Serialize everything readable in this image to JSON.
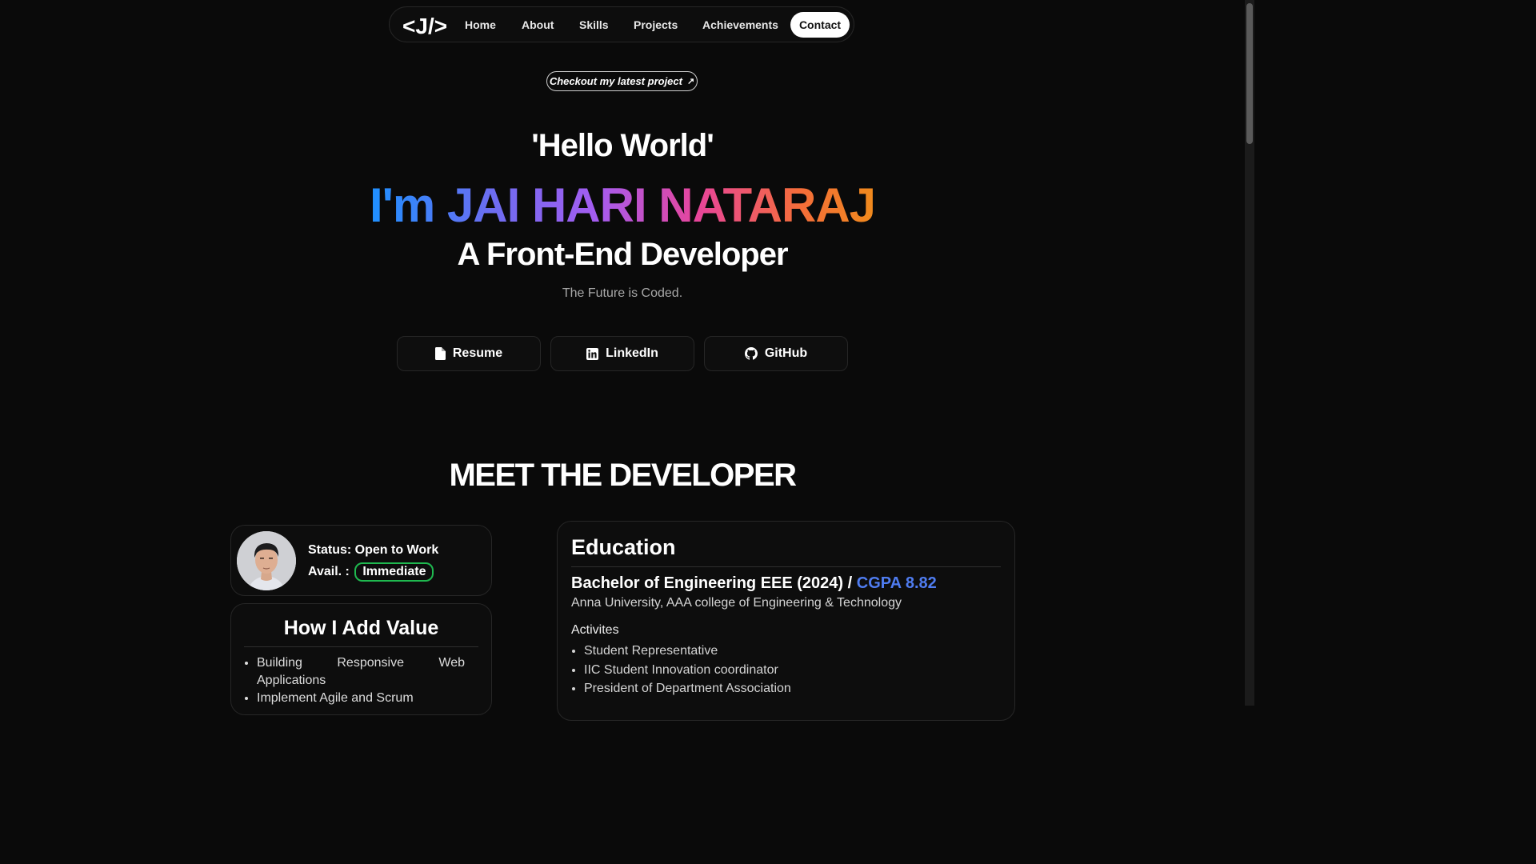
{
  "nav": {
    "logo": "</>",
    "logo_letter": "J",
    "items": [
      "Home",
      "About",
      "Skills",
      "Projects",
      "Achievements"
    ],
    "contact": "Contact"
  },
  "hero": {
    "latest_project": "Checkout my latest project",
    "latest_project_icon": "arrow-icon",
    "greeting": "'Hello World'",
    "name": "I'm JAI HARI NATARAJ",
    "role": "A Front-End Developer",
    "tagline": "The Future is Coded.",
    "buttons": {
      "resume": "Resume",
      "linkedin": "LinkedIn",
      "github": "GitHub"
    }
  },
  "meet": {
    "title": "MEET THE DEVELOPER",
    "status_label": "Status: Open to Work",
    "avail_label": "Avail. :",
    "avail_badge": "Immediate",
    "value_title": "How I Add Value",
    "value_items": [
      "Building Responsive Web Applications",
      "Implement Agile and Scrum"
    ]
  },
  "education": {
    "title": "Education",
    "degree": "Bachelor of Engineering EEE (2024) / ",
    "gpa": "CGPA 8.82",
    "university": "Anna University, AAA college of Engineering & Technology",
    "activities_title": "Activites",
    "activities": [
      "Student Representative",
      "IIC Student Innovation coordinator",
      "President of Department Association"
    ]
  },
  "colors": {
    "background": "#0a0a0a",
    "accent_blue": "#4f7cf0",
    "badge_green": "#1fb84f",
    "gradient": [
      "#1e90ff",
      "#a55cf0",
      "#e8459a",
      "#f08a1c"
    ]
  }
}
